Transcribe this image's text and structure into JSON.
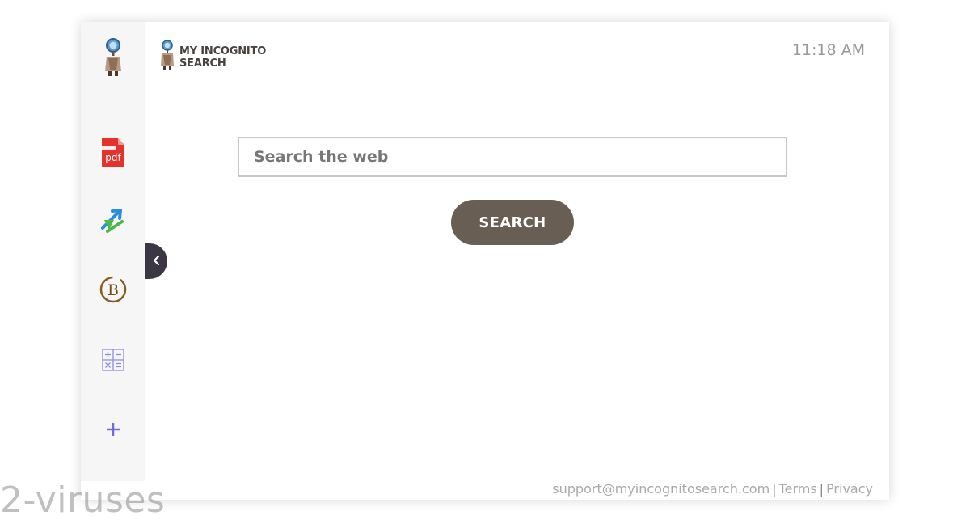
{
  "header": {
    "logo_line1": "MY INCOGNITO",
    "logo_line2": "SEARCH",
    "clock": "11:18 AM"
  },
  "sidebar": {
    "items": [
      {
        "icon": "detective-logo-icon"
      },
      {
        "icon": "pdf-icon",
        "label": "pdf"
      },
      {
        "icon": "converter-arrows-icon"
      },
      {
        "icon": "bitcoin-icon",
        "label": "B"
      },
      {
        "icon": "calculator-icon"
      },
      {
        "icon": "add-icon"
      }
    ],
    "toggle_icon": "chevron-left-icon"
  },
  "search": {
    "placeholder": "Search the web",
    "button_label": "SEARCH"
  },
  "footer": {
    "email": "support@myincognitosearch.com",
    "separator": "|",
    "terms": "Terms",
    "privacy": "Privacy"
  },
  "watermark": "2-viruses",
  "colors": {
    "search_button": "#685e53",
    "sidebar_bg": "#f6f6f6",
    "toggle_bg": "#3b3644",
    "pdf_red": "#e5322d",
    "plus_purple": "#6d6ae0"
  }
}
